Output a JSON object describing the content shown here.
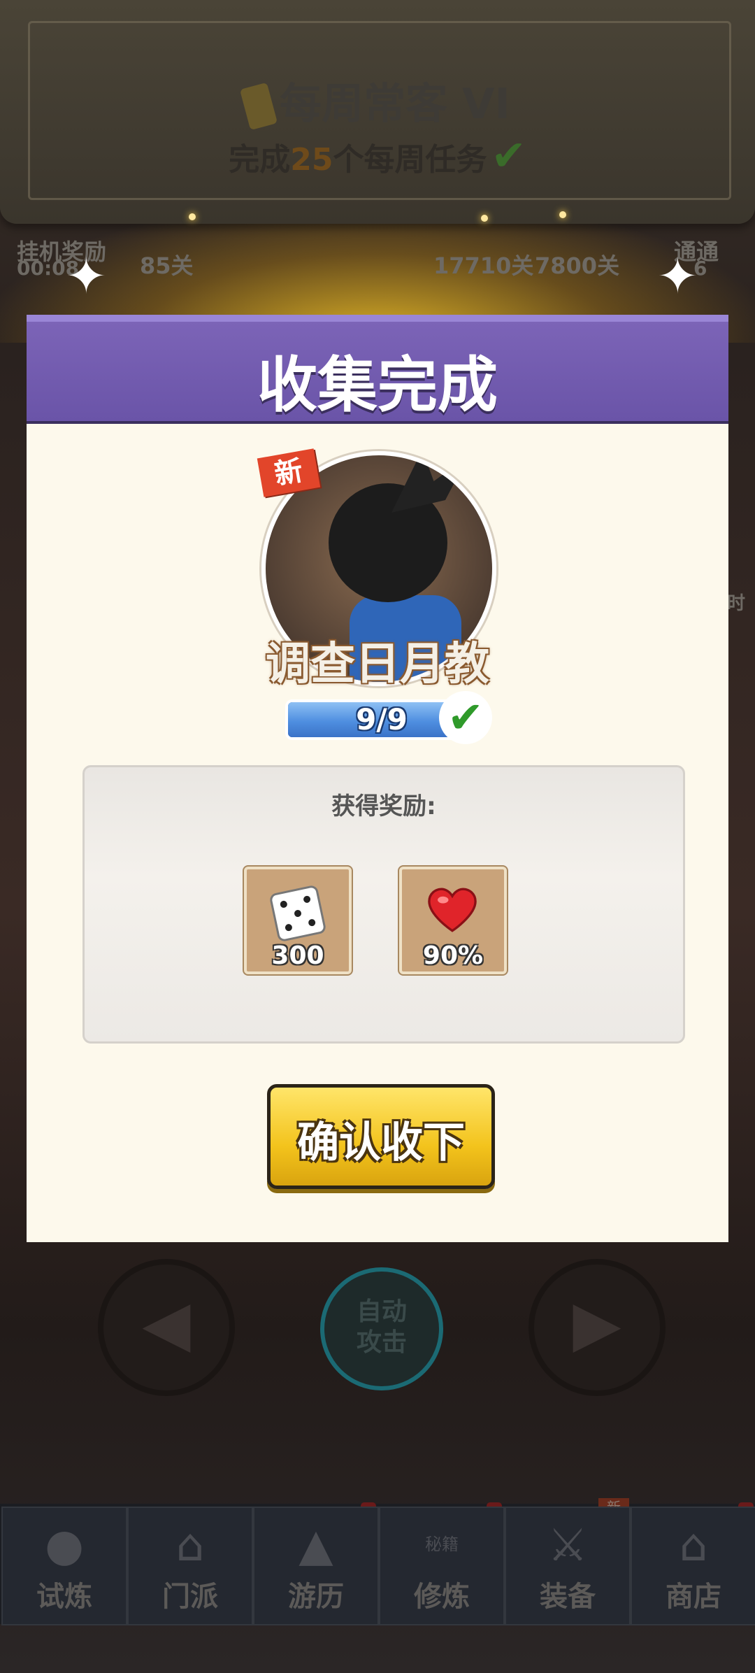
{
  "weekly_banner": {
    "title": "每周常客 VI",
    "subtitle_prefix": "完成",
    "subtitle_count": "25",
    "subtitle_suffix": "个每周任务",
    "check_icon": "check-icon"
  },
  "hud": {
    "idle_reward_label": "挂机奖励",
    "idle_reward_time": "00:08",
    "stage_label": "85关",
    "stage_progress": "17710关",
    "stage_target": "7800关",
    "clear_label": "通通",
    "clear_count": "6",
    "side_label": "时"
  },
  "modal": {
    "title": "收集完成",
    "new_tag": "新",
    "item_name": "调查日月教",
    "progress_text": "9/9",
    "progress_fraction": 1.0,
    "rewards_label": "获得奖励:",
    "rewards": [
      {
        "icon": "dice-icon",
        "amount": "300"
      },
      {
        "icon": "heart-icon",
        "amount": "90%"
      }
    ],
    "confirm_label": "确认收下"
  },
  "controls": {
    "left_icon": "arrow-left-icon",
    "right_icon": "arrow-right-icon",
    "auto_attack_line1": "自动",
    "auto_attack_line2": "攻击"
  },
  "tabs": [
    {
      "label": "试炼",
      "icon": "ninja-icon"
    },
    {
      "label": "门派",
      "icon": "temple-icon"
    },
    {
      "label": "游历",
      "icon": "landscape-icon"
    },
    {
      "label": "修炼",
      "icon": "scroll-icon",
      "icon_text": "秘籍"
    },
    {
      "label": "装备",
      "icon": "sword-icon",
      "badge": "新"
    },
    {
      "label": "商店",
      "icon": "shop-icon"
    }
  ],
  "colors": {
    "modal_header": "#6a54a8",
    "modal_body": "#fdf9ec",
    "confirm_button": "#f3c31c",
    "progress_bar": "#4f8fe0",
    "new_tag": "#e2452a"
  }
}
